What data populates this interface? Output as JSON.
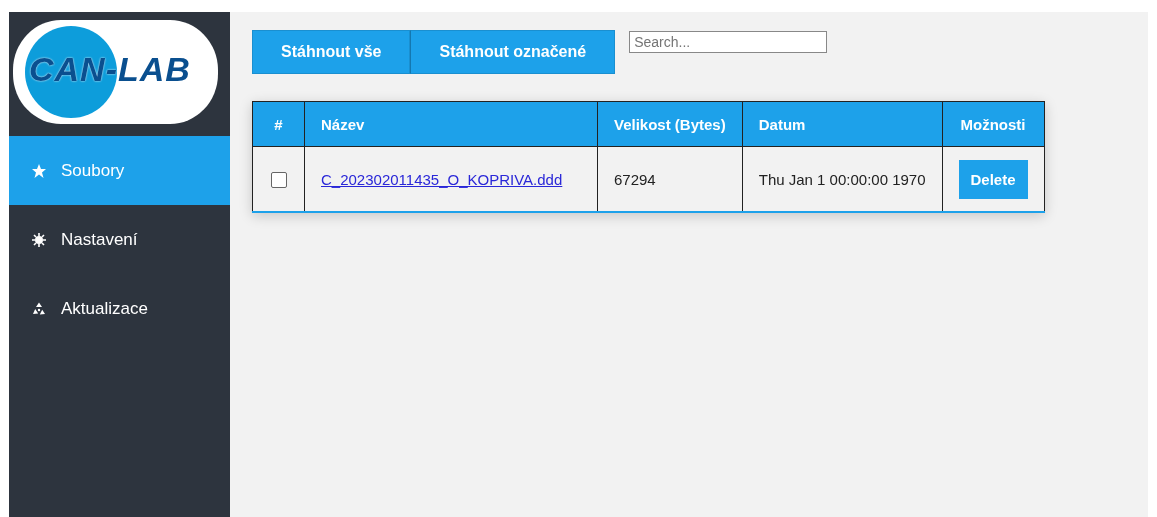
{
  "logo": {
    "text": "CAN-LAB"
  },
  "sidebar": {
    "items": [
      {
        "label": "Soubory",
        "selected": true
      },
      {
        "label": "Nastavení",
        "selected": false
      },
      {
        "label": "Aktualizace",
        "selected": false
      }
    ]
  },
  "toolbar": {
    "buttons": [
      "Stáhnout vše",
      "Stáhnout označené"
    ]
  },
  "search": {
    "placeholder": "Search..."
  },
  "table": {
    "columns": [
      "#",
      "Název",
      "Velikost (Bytes)",
      "Datum",
      "Možnosti"
    ],
    "rows": [
      {
        "checked": false,
        "name": "C_202302011435_O_KOPRIVA.ddd",
        "size": "67294",
        "date": "Thu Jan 1 00:00:00 1970",
        "action": "Delete"
      }
    ]
  }
}
